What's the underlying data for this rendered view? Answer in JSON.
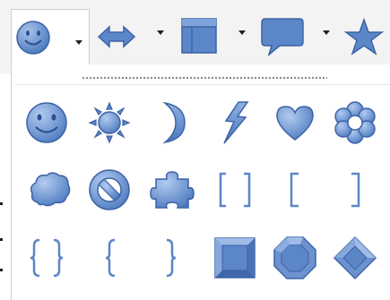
{
  "toolbar": {
    "buttons": [
      {
        "name": "smiley-shapes-button",
        "icon": "smiley-icon",
        "active": true
      },
      {
        "name": "arrow-shapes-button",
        "icon": "double-arrow-icon",
        "active": false
      },
      {
        "name": "flowchart-shapes-button",
        "icon": "flowchart-icon",
        "active": false
      },
      {
        "name": "callout-shapes-button",
        "icon": "callout-icon",
        "active": false
      },
      {
        "name": "star-shapes-button",
        "icon": "star-icon",
        "active": false
      }
    ]
  },
  "palette": {
    "rows": [
      [
        "smiley-face",
        "sun",
        "moon",
        "lightning-bolt",
        "heart",
        "flower"
      ],
      [
        "cloud",
        "prohibited-symbol",
        "puzzle-piece",
        "double-bracket",
        "left-bracket",
        "right-bracket"
      ],
      [
        "double-brace",
        "left-brace",
        "right-brace",
        "square-bevel",
        "octagon-bevel",
        "diamond-bevel"
      ]
    ]
  },
  "colors": {
    "shape_fill": "#5b86c7",
    "shape_stroke": "#3c63a6",
    "shape_highlight": "#a9c3ea",
    "toolbar_bg": "#f3f3f3"
  }
}
